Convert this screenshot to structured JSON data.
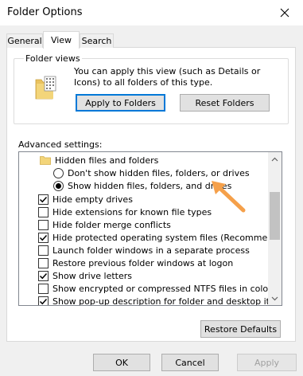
{
  "window": {
    "title": "Folder Options",
    "close_icon": "close-icon"
  },
  "tabs": [
    {
      "label": "General",
      "active": false
    },
    {
      "label": "View",
      "active": true
    },
    {
      "label": "Search",
      "active": false
    }
  ],
  "folder_views": {
    "legend": "Folder views",
    "icon": "folder-view-icon",
    "description": "You can apply this view (such as Details or Icons) to all folders of this type.",
    "apply_button": "Apply to Folders",
    "reset_button": "Reset Folders"
  },
  "advanced": {
    "label": "Advanced settings:",
    "items": [
      {
        "type": "folder",
        "label": "Hidden files and folders"
      },
      {
        "type": "radio",
        "label": "Don't show hidden files, folders, or drives",
        "checked": false
      },
      {
        "type": "radio",
        "label": "Show hidden files, folders, and drives",
        "checked": true
      },
      {
        "type": "checkbox",
        "label": "Hide empty drives",
        "checked": true
      },
      {
        "type": "checkbox",
        "label": "Hide extensions for known file types",
        "checked": false
      },
      {
        "type": "checkbox",
        "label": "Hide folder merge conflicts",
        "checked": false
      },
      {
        "type": "checkbox",
        "label": "Hide protected operating system files (Recommended)",
        "checked": true
      },
      {
        "type": "checkbox",
        "label": "Launch folder windows in a separate process",
        "checked": false
      },
      {
        "type": "checkbox",
        "label": "Restore previous folder windows at logon",
        "checked": false
      },
      {
        "type": "checkbox",
        "label": "Show drive letters",
        "checked": true
      },
      {
        "type": "checkbox",
        "label": "Show encrypted or compressed NTFS files in color",
        "checked": false
      },
      {
        "type": "checkbox",
        "label": "Show pop-up description for folder and desktop items",
        "checked": true
      }
    ],
    "restore_button": "Restore Defaults"
  },
  "footer": {
    "ok": "OK",
    "cancel": "Cancel",
    "apply": "Apply",
    "apply_disabled": true
  },
  "colors": {
    "accent": "#0078d7",
    "annotation_arrow": "#f5a04a",
    "folder_yellow": "#f3d57a"
  }
}
